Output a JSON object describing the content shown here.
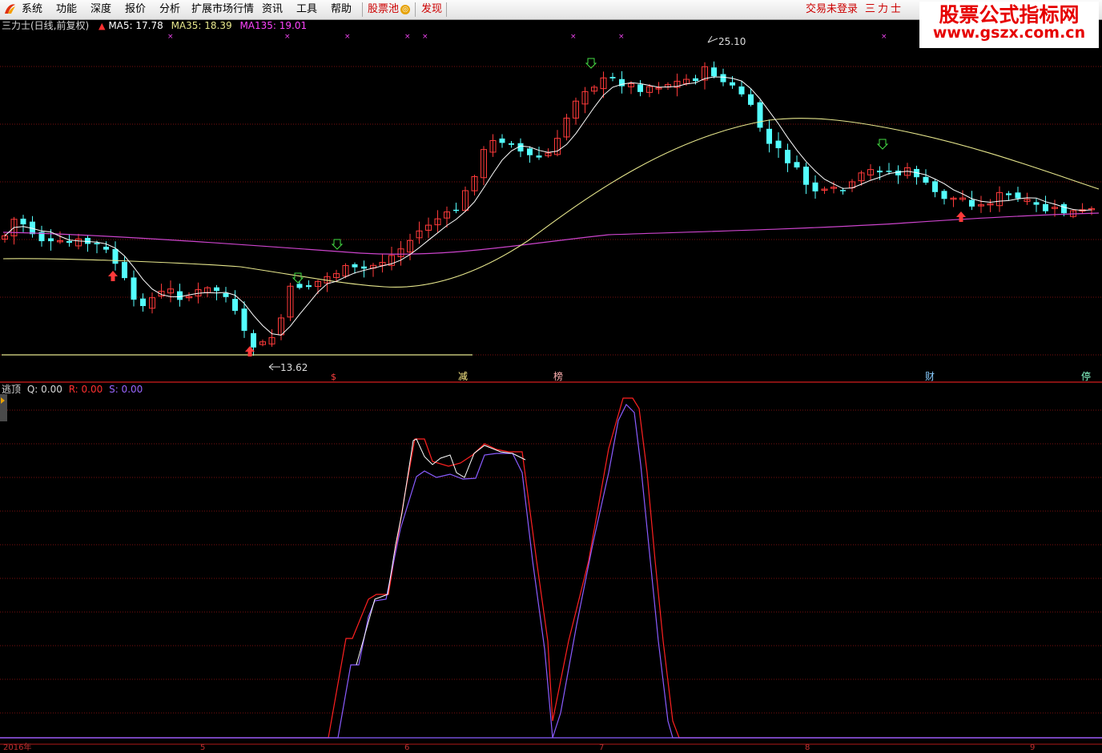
{
  "menubar": {
    "items": [
      "系统",
      "功能",
      "深度",
      "报价",
      "分析",
      "扩展市场行情",
      "资讯",
      "工具",
      "帮助"
    ],
    "pool_label": "股票池",
    "find_label": "发现",
    "login_status": "交易未登录",
    "stock_title": "三力士"
  },
  "watermark": {
    "line1": "股票公式指标网",
    "line2": "www.gszx.com.cn"
  },
  "main_chart": {
    "stock_name": "三力士(日线,前复权)",
    "ma5_label": "MA5: 17.78",
    "ma35_label": "MA35: 18.39",
    "ma135_label": "MA135: 19.01",
    "high_label": "25.10",
    "low_label": "13.62",
    "event_markers": [
      "$",
      "减",
      "榜",
      "财",
      "停"
    ]
  },
  "indicator": {
    "name": "逃顶",
    "q_label": "Q: 0.00",
    "r_label": "R: 0.00",
    "s_label": "S: 0.00"
  },
  "date_axis": {
    "labels": [
      "2016年",
      "5",
      "6",
      "7",
      "8",
      "9"
    ]
  },
  "colors": {
    "background": "#000000",
    "rise": "#ff3a3a",
    "fall": "#54ffff",
    "ma5": "#ffffff",
    "ma35": "#e6e68c",
    "ma135": "#cc44cc",
    "grid": "#7a1010",
    "r_line": "#ff2020",
    "s_line": "#8a5cff",
    "q_line": "#ffffff"
  },
  "icons": [
    "app-logo-icon",
    "buy-arrow-icon",
    "sell-arrow-icon",
    "pool-badge-icon",
    "side-tab-arrow-icon"
  ]
}
